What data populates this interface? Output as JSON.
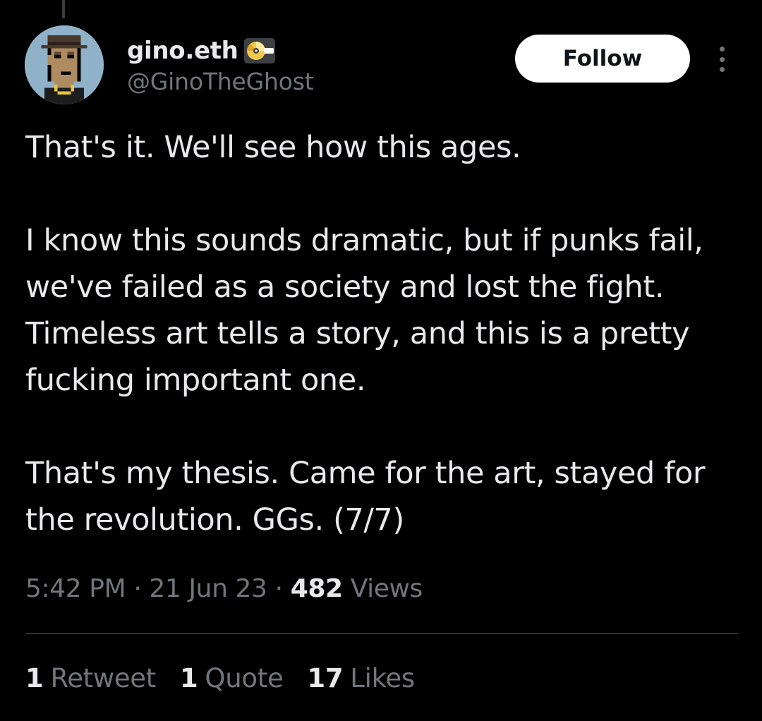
{
  "author": {
    "display_name": "gino.eth",
    "handle": "@GinoTheGhost",
    "avatar_icon": "cryptopunk-avatar-icon",
    "badge_icon": "cd-disc-badge-icon"
  },
  "actions": {
    "follow_label": "Follow",
    "more_icon": "more-vertical-icon"
  },
  "tweet": {
    "paragraphs": [
      "That's it. We'll see how this ages.",
      "I know this sounds dramatic, but if punks fail, we've failed as a society and lost the fight. Timeless art tells a story, and this is a pretty fucking important one.",
      "That's my thesis. Came for the art, stayed for the revolution. GGs. (7/7)"
    ]
  },
  "meta": {
    "time": "5:42 PM",
    "separator": "·",
    "date": "21 Jun 23",
    "views_count": "482",
    "views_label": "Views"
  },
  "stats": {
    "retweets_count": "1",
    "retweets_label": "Retweet",
    "quotes_count": "1",
    "quotes_label": "Quote",
    "likes_count": "17",
    "likes_label": "Likes"
  },
  "colors": {
    "background": "#000000",
    "primary_text": "#e7e9ea",
    "secondary_text": "#71767b",
    "divider": "#2f3336",
    "follow_bg": "#ffffff"
  }
}
